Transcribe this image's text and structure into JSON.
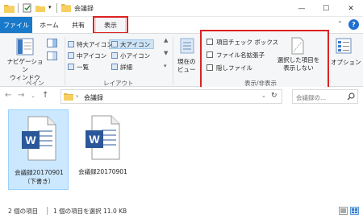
{
  "window": {
    "title": "会議録",
    "minimize": "—",
    "maximize": "☐",
    "close": "✕"
  },
  "tabs": {
    "file": "ファイル",
    "home": "ホーム",
    "share": "共有",
    "view": "表示"
  },
  "ribbon": {
    "pane": {
      "nav_label": "ナビゲーション\nウィンドウ",
      "group_label": "ペイン"
    },
    "layout": {
      "items": [
        "特大アイコン",
        "大アイコン",
        "中アイコン",
        "小アイコン",
        "一覧",
        "詳細"
      ],
      "group_label": "レイアウト"
    },
    "current_view": {
      "label": "現在の\nビュー"
    },
    "show_hide": {
      "checkboxes": [
        "項目チェック ボックス",
        "ファイル名拡張子",
        "隠しファイル"
      ],
      "hide_selected": "選択した項目を\n表示しない",
      "group_label": "表示/非表示"
    },
    "options": {
      "label": "オプション"
    }
  },
  "address": {
    "path": "会議録",
    "search_placeholder": "会議録の..."
  },
  "files": [
    {
      "name": "会議録20170901\n（下書き）",
      "selected": true
    },
    {
      "name": "会議録20170901",
      "selected": false
    }
  ],
  "status": {
    "count": "2 個の項目",
    "selection": "1 個の項目を選択  11.0 KB"
  },
  "colors": {
    "accent": "#1979ca",
    "highlight": "#d22222",
    "word_blue": "#2b579a",
    "selection": "#cce8ff"
  }
}
